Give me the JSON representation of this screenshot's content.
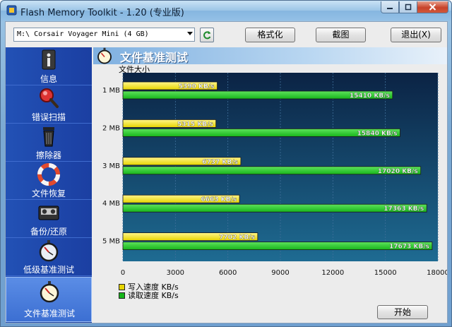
{
  "window": {
    "title": "Flash Memory Toolkit - 1.20 (专业版)",
    "minimize_icon": "minimize-icon",
    "maximize_icon": "maximize-icon",
    "close_icon": "close-icon"
  },
  "toolbar": {
    "drive_value": "M:\\ Corsair Voyager Mini (4 GB)",
    "refresh_icon": "refresh-icon",
    "format_label": "格式化",
    "screenshot_label": "截图",
    "exit_label": "退出(X)"
  },
  "sidebar": {
    "items": [
      {
        "label": "信息",
        "icon": "info-icon"
      },
      {
        "label": "错误扫描",
        "icon": "magnifier-icon"
      },
      {
        "label": "擦除器",
        "icon": "trash-icon"
      },
      {
        "label": "文件恢复",
        "icon": "lifebuoy-icon"
      },
      {
        "label": "备份/还原",
        "icon": "tape-icon"
      },
      {
        "label": "低级基准测试",
        "icon": "stopwatch-icon"
      },
      {
        "label": "文件基准测试",
        "icon": "stopwatch-icon"
      }
    ],
    "active_index": 6
  },
  "main": {
    "heading": "文件基准测试",
    "start_label": "开始"
  },
  "colors": {
    "write": "#e6d400",
    "read": "#17b51b",
    "chart_bg_top": "#0b2344",
    "chart_bg_bottom": "#1e6b92"
  },
  "chart_data": {
    "type": "bar",
    "orientation": "horizontal",
    "title": "",
    "ylabel": "文件大小",
    "xlabel": "",
    "categories": [
      "1 MB",
      "2 MB",
      "3 MB",
      "4 MB",
      "5 MB"
    ],
    "series": [
      {
        "name": "写入速度 KB/s",
        "values": [
          5390,
          5315,
          6737,
          6663,
          7702
        ],
        "labels": [
          "5390 KB/s",
          "5315 KB/s",
          "6737 KB/s",
          "6663 KB/s",
          "7702 KB/s"
        ]
      },
      {
        "name": "读取速度 KB/s",
        "values": [
          15410,
          15840,
          17020,
          17363,
          17673
        ],
        "labels": [
          "15410 KB/s",
          "15840 KB/s",
          "17020 KB/s",
          "17363 KB/s",
          "17673 KB/s"
        ]
      }
    ],
    "xlim": [
      0,
      18000
    ],
    "xticks": [
      0,
      3000,
      6000,
      9000,
      12000,
      15000,
      18000
    ],
    "xtick_labels": [
      "0",
      "3000",
      "6000",
      "9000",
      "12000",
      "15000",
      "18000"
    ],
    "grid": true,
    "legend_placement": "bottom-left"
  }
}
